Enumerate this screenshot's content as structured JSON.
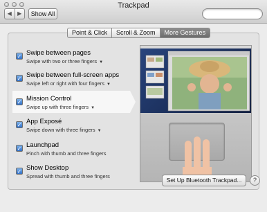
{
  "window": {
    "title": "Trackpad"
  },
  "toolbar": {
    "back_label": "◀",
    "forward_label": "▶",
    "show_all_label": "Show All",
    "search_value": ""
  },
  "tabs": [
    {
      "label": "Point & Click",
      "active": false
    },
    {
      "label": "Scroll & Zoom",
      "active": false
    },
    {
      "label": "More Gestures",
      "active": true
    }
  ],
  "gestures": [
    {
      "name": "Swipe between pages",
      "description": "Swipe with two or three fingers",
      "has_menu": true,
      "checked": true
    },
    {
      "name": "Swipe between full-screen apps",
      "description": "Swipe left or right with four fingers",
      "has_menu": true,
      "checked": true
    },
    {
      "name": "Mission Control",
      "description": "Swipe up with three fingers",
      "has_menu": true,
      "checked": true,
      "selected": true
    },
    {
      "name": "App Exposé",
      "description": "Swipe down with three fingers",
      "has_menu": true,
      "checked": true
    },
    {
      "name": "Launchpad",
      "description": "Pinch with thumb and three fingers",
      "has_menu": false,
      "checked": true
    },
    {
      "name": "Show Desktop",
      "description": "Spread with thumb and three fingers",
      "has_menu": false,
      "checked": true
    }
  ],
  "checkmark": "✓",
  "menu_caret": "▼",
  "footer": {
    "bluetooth_button_label": "Set Up Bluetooth Trackpad...",
    "help_label": "?"
  },
  "colors": {
    "checkbox_blue": "#2f6fc8",
    "active_tab": "#7a7a7a",
    "desktop_blue": "#1f3566"
  }
}
